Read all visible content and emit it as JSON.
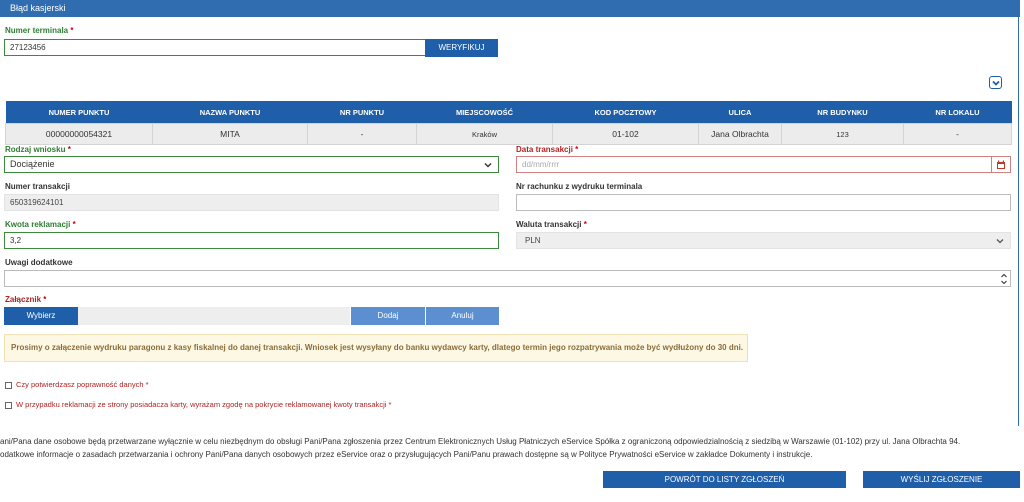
{
  "window": {
    "title": "Błąd kasjerski"
  },
  "terminal": {
    "label": "Numer terminala",
    "required": "*",
    "value": "27123456",
    "verify_label": "WERYFIKUJ"
  },
  "table": {
    "headers": [
      "NUMER PUNKTU",
      "NAZWA PUNKTU",
      "NR PUNKTU",
      "MIEJSCOWOŚĆ",
      "KOD POCZTOWY",
      "ULICA",
      "NR BUDYNKU",
      "NR LOKALU"
    ],
    "row": [
      "00000000054321",
      "MITA",
      "-",
      "Kraków",
      "01-102",
      "Jana Olbrachta",
      "123",
      "-"
    ]
  },
  "form": {
    "request_type": {
      "label": "Rodzaj wniosku",
      "required": "*",
      "value": "Dociążenie"
    },
    "transaction_date": {
      "label": "Data transakcji",
      "required": "*",
      "placeholder": "dd/mm/rrrr"
    },
    "transaction_number": {
      "label": "Numer transakcji",
      "value": "650319624101"
    },
    "account_number": {
      "label": "Nr rachunku z wydruku terminala",
      "value": ""
    },
    "amount": {
      "label": "Kwota reklamacji",
      "required": "*",
      "value": "3,2"
    },
    "currency": {
      "label": "Waluta transakcji",
      "required": "*",
      "value": "PLN"
    },
    "notes": {
      "label": "Uwagi dodatkowe",
      "value": ""
    },
    "attachment": {
      "label": "Załącznik",
      "required": "*",
      "choose_label": "Wybierz",
      "add_label": "Dodaj",
      "cancel_label": "Anuluj"
    }
  },
  "notice": "Prosimy o załączenie wydruku paragonu z kasy fiskalnej do danej transakcji. Wniosek jest wysyłany do banku wydawcy karty, dlatego termin jego rozpatrywania może być wydłużony do 30 dni.",
  "consents": [
    {
      "label": "Czy potwierdzasz poprawność danych",
      "required": "*"
    },
    {
      "label": "W przypadku reklamacji ze strony posiadacza karty, wyrażam zgodę na pokrycie reklamowanej kwoty transakcji",
      "required": "*"
    }
  ],
  "footer": {
    "line1": "ani/Pana dane osobowe będą przetwarzane wyłącznie w celu niezbędnym do obsługi Pani/Pana zgłoszenia przez Centrum Elektronicznych Usług Płatniczych eService Spółka z ograniczoną odpowiedzialnością z siedzibą w Warszawie (01-102) przy ul. Jana Olbrachta 94.",
    "line2": "odatkowe informacje o zasadach przetwarzania i ochrony Pani/Pana danych osobowych przez eService oraz o przysługujących Pani/Panu prawach dostępne są w Polityce Prywatności eService w zakładce Dokumenty i instrukcje.",
    "back_label": "POWRÓT DO LISTY ZGŁOSZEŃ",
    "submit_label": "WYŚLIJ ZGŁOSZENIE"
  },
  "colors": {
    "primary": "#1f5ea8",
    "title_bar": "#2f6db0",
    "notice_bg": "#fcf8e3",
    "notice_text": "#8a6d3b",
    "required": "#b22222",
    "valid": "#2e7d32"
  }
}
